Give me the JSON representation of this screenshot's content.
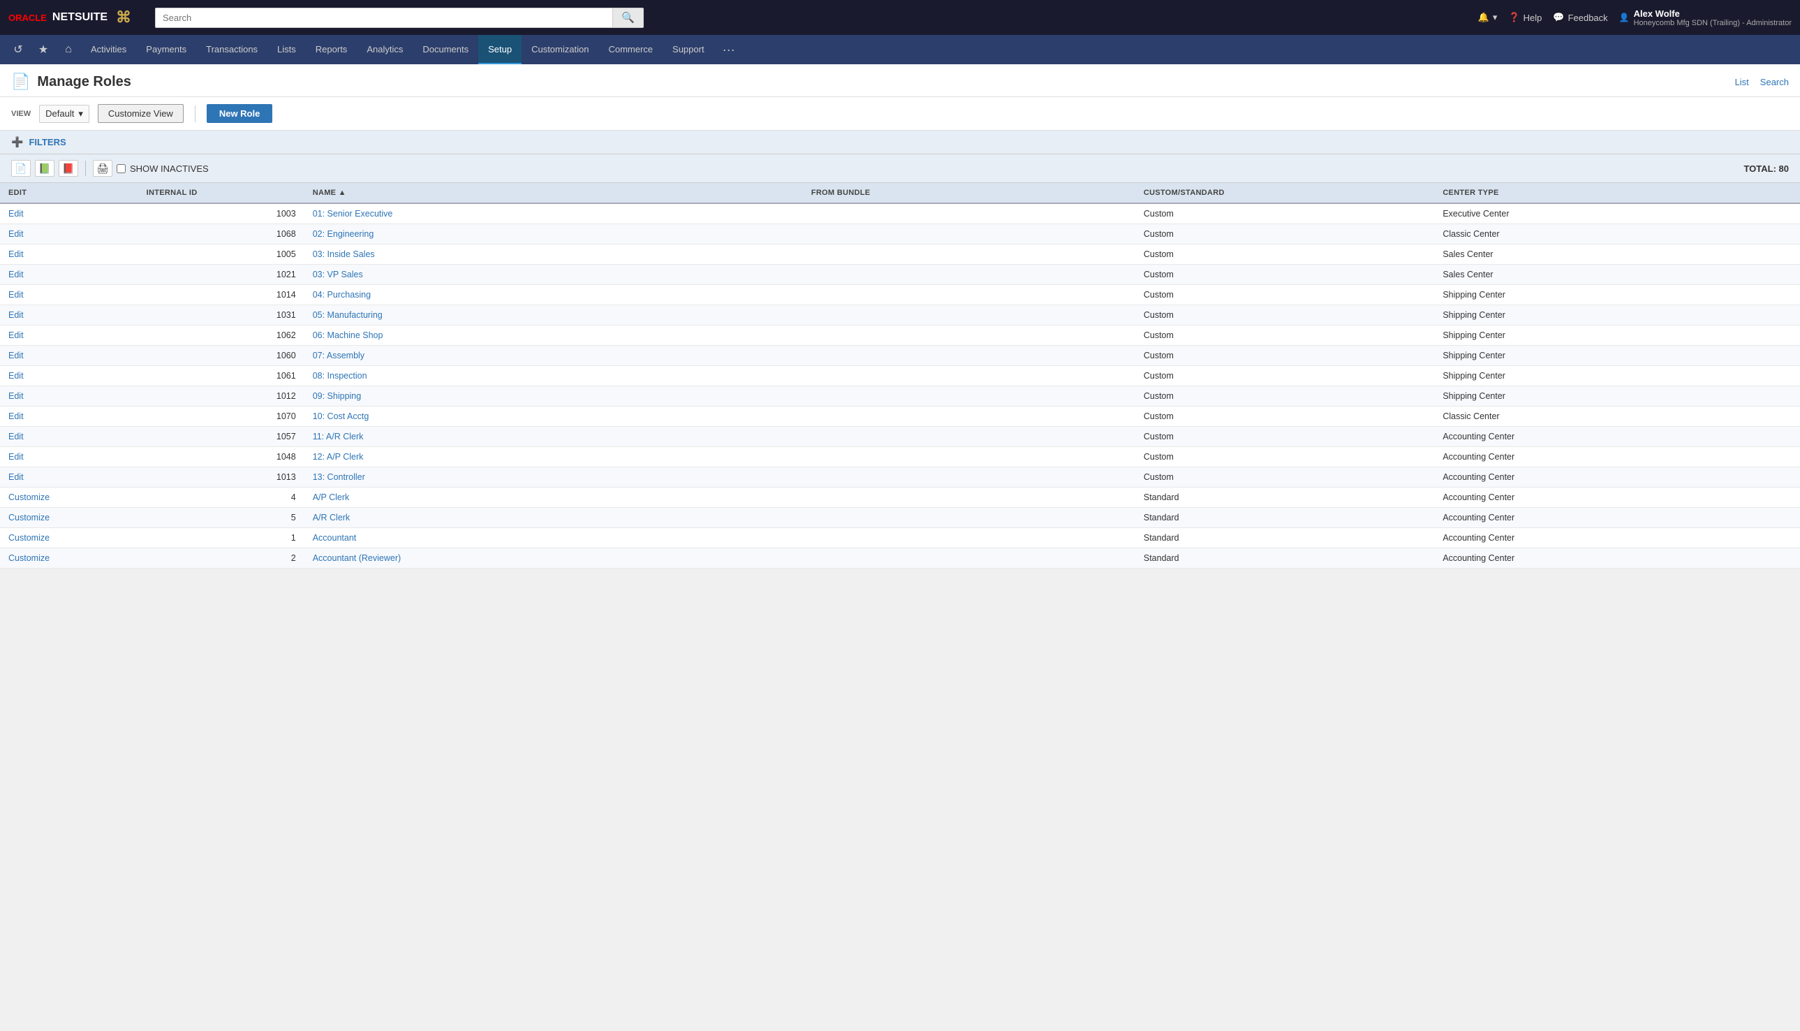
{
  "app": {
    "oracle_label": "ORACLE",
    "netsuite_label": "NETSUITE"
  },
  "top_bar": {
    "search_placeholder": "Search",
    "search_btn_icon": "🔍",
    "notification_icon": "🔔",
    "help_label": "Help",
    "feedback_label": "Feedback",
    "user_name": "Alex Wolfe",
    "user_company": "Honeycomb Mfg SDN (Trailing) - Administrator",
    "user_icon": "👤"
  },
  "nav": {
    "items": [
      {
        "label": "Activities",
        "active": false
      },
      {
        "label": "Payments",
        "active": false
      },
      {
        "label": "Transactions",
        "active": false
      },
      {
        "label": "Lists",
        "active": false
      },
      {
        "label": "Reports",
        "active": false
      },
      {
        "label": "Analytics",
        "active": false
      },
      {
        "label": "Documents",
        "active": false
      },
      {
        "label": "Setup",
        "active": true
      },
      {
        "label": "Customization",
        "active": false
      },
      {
        "label": "Commerce",
        "active": false
      },
      {
        "label": "Support",
        "active": false
      }
    ],
    "more_icon": "···"
  },
  "page": {
    "title": "Manage Roles",
    "icon": "📄",
    "actions": [
      {
        "label": "List"
      },
      {
        "label": "Search"
      }
    ]
  },
  "toolbar": {
    "view_label": "VIEW",
    "view_value": "Default",
    "customize_view_label": "Customize View",
    "new_role_label": "New Role"
  },
  "filters": {
    "icon": "➕",
    "label": "FILTERS"
  },
  "table_toolbar": {
    "icons": [
      {
        "name": "plain-text-icon",
        "symbol": "📄"
      },
      {
        "name": "excel-icon",
        "symbol": "📗"
      },
      {
        "name": "pdf-icon",
        "symbol": "📕"
      },
      {
        "name": "print-icon",
        "symbol": "🖨"
      }
    ],
    "show_inactives_label": "SHOW INACTIVES",
    "total_label": "TOTAL: 80"
  },
  "table": {
    "columns": [
      {
        "key": "edit",
        "label": "EDIT"
      },
      {
        "key": "internal_id",
        "label": "INTERNAL ID"
      },
      {
        "key": "name",
        "label": "NAME ▲"
      },
      {
        "key": "from_bundle",
        "label": "FROM BUNDLE"
      },
      {
        "key": "custom_standard",
        "label": "CUSTOM/STANDARD"
      },
      {
        "key": "center_type",
        "label": "CENTER TYPE"
      }
    ],
    "rows": [
      {
        "edit": "Edit",
        "internal_id": "1003",
        "name": "01: Senior Executive",
        "from_bundle": "",
        "custom_standard": "Custom",
        "center_type": "Executive Center",
        "edit_type": "link",
        "name_type": "link"
      },
      {
        "edit": "Edit",
        "internal_id": "1068",
        "name": "02: Engineering",
        "from_bundle": "",
        "custom_standard": "Custom",
        "center_type": "Classic Center",
        "edit_type": "link",
        "name_type": "link"
      },
      {
        "edit": "Edit",
        "internal_id": "1005",
        "name": "03: Inside Sales",
        "from_bundle": "",
        "custom_standard": "Custom",
        "center_type": "Sales Center",
        "edit_type": "link",
        "name_type": "link"
      },
      {
        "edit": "Edit",
        "internal_id": "1021",
        "name": "03: VP Sales",
        "from_bundle": "",
        "custom_standard": "Custom",
        "center_type": "Sales Center",
        "edit_type": "link",
        "name_type": "link"
      },
      {
        "edit": "Edit",
        "internal_id": "1014",
        "name": "04: Purchasing",
        "from_bundle": "",
        "custom_standard": "Custom",
        "center_type": "Shipping Center",
        "edit_type": "link",
        "name_type": "link"
      },
      {
        "edit": "Edit",
        "internal_id": "1031",
        "name": "05: Manufacturing",
        "from_bundle": "",
        "custom_standard": "Custom",
        "center_type": "Shipping Center",
        "edit_type": "link",
        "name_type": "link"
      },
      {
        "edit": "Edit",
        "internal_id": "1062",
        "name": "06: Machine Shop",
        "from_bundle": "",
        "custom_standard": "Custom",
        "center_type": "Shipping Center",
        "edit_type": "link",
        "name_type": "link"
      },
      {
        "edit": "Edit",
        "internal_id": "1060",
        "name": "07: Assembly",
        "from_bundle": "",
        "custom_standard": "Custom",
        "center_type": "Shipping Center",
        "edit_type": "link",
        "name_type": "link"
      },
      {
        "edit": "Edit",
        "internal_id": "1061",
        "name": "08: Inspection",
        "from_bundle": "",
        "custom_standard": "Custom",
        "center_type": "Shipping Center",
        "edit_type": "link",
        "name_type": "link"
      },
      {
        "edit": "Edit",
        "internal_id": "1012",
        "name": "09: Shipping",
        "from_bundle": "",
        "custom_standard": "Custom",
        "center_type": "Shipping Center",
        "edit_type": "link",
        "name_type": "link"
      },
      {
        "edit": "Edit",
        "internal_id": "1070",
        "name": "10: Cost Acctg",
        "from_bundle": "",
        "custom_standard": "Custom",
        "center_type": "Classic Center",
        "edit_type": "link",
        "name_type": "link"
      },
      {
        "edit": "Edit",
        "internal_id": "1057",
        "name": "11: A/R Clerk",
        "from_bundle": "",
        "custom_standard": "Custom",
        "center_type": "Accounting Center",
        "edit_type": "link",
        "name_type": "link"
      },
      {
        "edit": "Edit",
        "internal_id": "1048",
        "name": "12: A/P Clerk",
        "from_bundle": "",
        "custom_standard": "Custom",
        "center_type": "Accounting Center",
        "edit_type": "link",
        "name_type": "link"
      },
      {
        "edit": "Edit",
        "internal_id": "1013",
        "name": "13: Controller",
        "from_bundle": "",
        "custom_standard": "Custom",
        "center_type": "Accounting Center",
        "edit_type": "link",
        "name_type": "link"
      },
      {
        "edit": "Customize",
        "internal_id": "4",
        "name": "A/P Clerk",
        "from_bundle": "",
        "custom_standard": "Standard",
        "center_type": "Accounting Center",
        "edit_type": "link",
        "name_type": "link"
      },
      {
        "edit": "Customize",
        "internal_id": "5",
        "name": "A/R Clerk",
        "from_bundle": "",
        "custom_standard": "Standard",
        "center_type": "Accounting Center",
        "edit_type": "link",
        "name_type": "link"
      },
      {
        "edit": "Customize",
        "internal_id": "1",
        "name": "Accountant",
        "from_bundle": "",
        "custom_standard": "Standard",
        "center_type": "Accounting Center",
        "edit_type": "link",
        "name_type": "link"
      },
      {
        "edit": "Customize",
        "internal_id": "2",
        "name": "Accountant (Reviewer)",
        "from_bundle": "",
        "custom_standard": "Standard",
        "center_type": "Accounting Center",
        "edit_type": "link",
        "name_type": "link"
      }
    ]
  }
}
